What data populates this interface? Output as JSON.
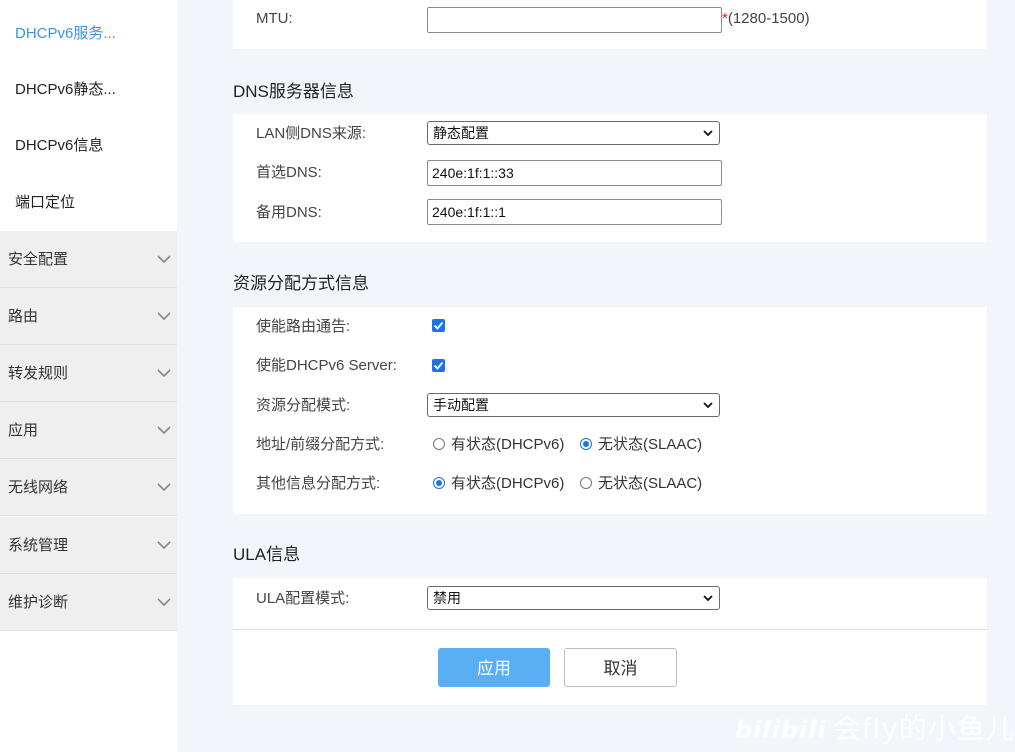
{
  "sidebar": {
    "sub_items": [
      {
        "label": "DHCPv6服务...",
        "active": true
      },
      {
        "label": "DHCPv6静态..."
      },
      {
        "label": "DHCPv6信息"
      },
      {
        "label": "端口定位"
      }
    ],
    "groups": [
      {
        "label": "安全配置"
      },
      {
        "label": "路由"
      },
      {
        "label": "转发规则"
      },
      {
        "label": "应用"
      },
      {
        "label": "无线网络"
      },
      {
        "label": "系统管理"
      },
      {
        "label": "维护诊断"
      }
    ]
  },
  "mtu": {
    "label": "MTU:",
    "value": "",
    "required_mark": "*",
    "range_hint": "(1280-1500)"
  },
  "dns_section": {
    "title": "DNS服务器信息",
    "source_label": "LAN侧DNS来源:",
    "source_value": "静态配置",
    "primary_label": "首选DNS:",
    "primary_value": "240e:1f:1::33",
    "secondary_label": "备用DNS:",
    "secondary_value": "240e:1f:1::1"
  },
  "resource_section": {
    "title": "资源分配方式信息",
    "router_adv_label": "使能路由通告:",
    "router_adv_checked": true,
    "dhcp_server_label": "使能DHCPv6 Server:",
    "dhcp_server_checked": true,
    "mode_label": "资源分配模式:",
    "mode_value": "手动配置",
    "addr_label": "地址/前缀分配方式:",
    "addr_options": [
      {
        "label": "有状态(DHCPv6)",
        "selected": false
      },
      {
        "label": "无状态(SLAAC)",
        "selected": true
      }
    ],
    "other_label": "其他信息分配方式:",
    "other_options": [
      {
        "label": "有状态(DHCPv6)",
        "selected": true
      },
      {
        "label": "无状态(SLAAC)",
        "selected": false
      }
    ]
  },
  "ula_section": {
    "title": "ULA信息",
    "mode_label": "ULA配置模式:",
    "mode_value": "禁用"
  },
  "actions": {
    "apply_label": "应用",
    "cancel_label": "取消"
  },
  "watermark": {
    "brand": "bilibili",
    "text": "会fly的小鱼儿"
  },
  "colors": {
    "accent": "#3a93e6",
    "apply_button": "#5aaef4",
    "checkbox": "#1a73e8",
    "page_bg": "#f3f5fa",
    "sidebar_group_bg": "#efefef"
  },
  "icons": {
    "group_chevron": "chevron-down-icon",
    "select_arrow": "chevron-down-icon",
    "checkbox_mark": "check-icon"
  }
}
